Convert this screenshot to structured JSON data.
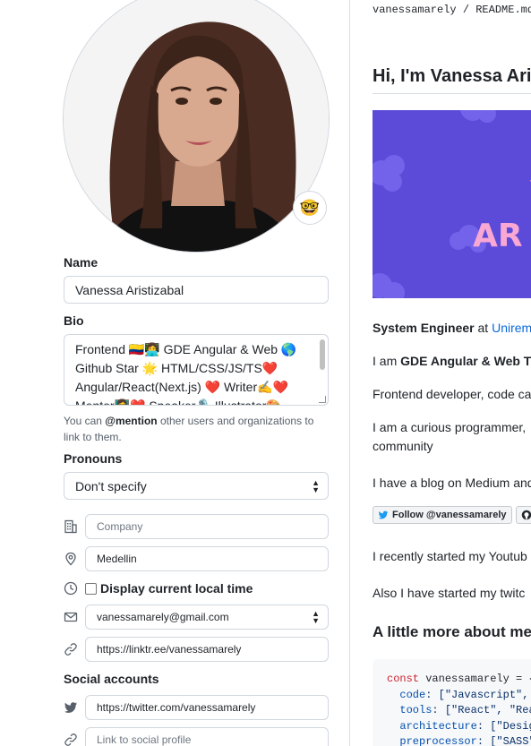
{
  "profile": {
    "emoji": "🤓",
    "name_label": "Name",
    "name_value": "Vanessa Aristizabal",
    "bio_label": "Bio",
    "bio_lines": [
      "Frontend 🇨🇴👩‍💻 GDE Angular & Web 🌎",
      "Github Star 🌟 HTML/CSS/JS/TS❤️",
      "Angular/React(Next.js) ❤️ Writer✍️❤️",
      "Mentor👩‍🏫❤️ Speaker🎙️ Illustrator🎨"
    ],
    "mention_prefix": "You can ",
    "mention_strong": "@mention",
    "mention_suffix": " other users and organizations to link to them.",
    "pronouns_label": "Pronouns",
    "pronouns_value": "Don't specify",
    "company_placeholder": "Company",
    "location_value": "Medellin",
    "local_time_label": "Display current local time",
    "email_value": "vanessamarely@gmail.com",
    "website_value": "https://linktr.ee/vanessamarely",
    "social_label": "Social accounts",
    "twitter_value": "https://twitter.com/vanessamarely",
    "social_placeholder": "Link to social profile"
  },
  "readme": {
    "path_user": "vanessamarely",
    "path_sep": " / ",
    "path_file": "README.md",
    "heading": "Hi, I'm Vanessa Ari",
    "banner_text_1": "V",
    "banner_text_2": "AR",
    "line1_strong": "System Engineer",
    "line1_mid": " at ",
    "line1_link": "Uniremi",
    "line2_prefix": "I am ",
    "line2_strong": "GDE Angular & Web Te",
    "line3": "Frontend developer, code ca",
    "line4a": "I am a curious programmer,",
    "line4b": "community",
    "line5": "I have a blog on Medium and",
    "badge_label": "Follow @vanessamarely",
    "line6": "I recently started my Youtub",
    "line7": "Also I have started my twitc",
    "subheading": "A little more about me",
    "code": {
      "l1_kw": "const",
      "l1_rest": " vanessamarely = {",
      "l2_key": "code",
      "l2_val": ": [\"Javascript\",",
      "l3_key": "tools",
      "l3_val": ": [\"React\", \"Rea",
      "l4_key": "architecture",
      "l4_val": ": [\"Desig",
      "l5_key": "preprocessor",
      "l5_val": ": [\"SASS\""
    }
  },
  "colors": {
    "link": "#0969da",
    "banner": "#5b4bd8",
    "banner_text": "#f9a8d4",
    "border": "#d0d7de"
  }
}
